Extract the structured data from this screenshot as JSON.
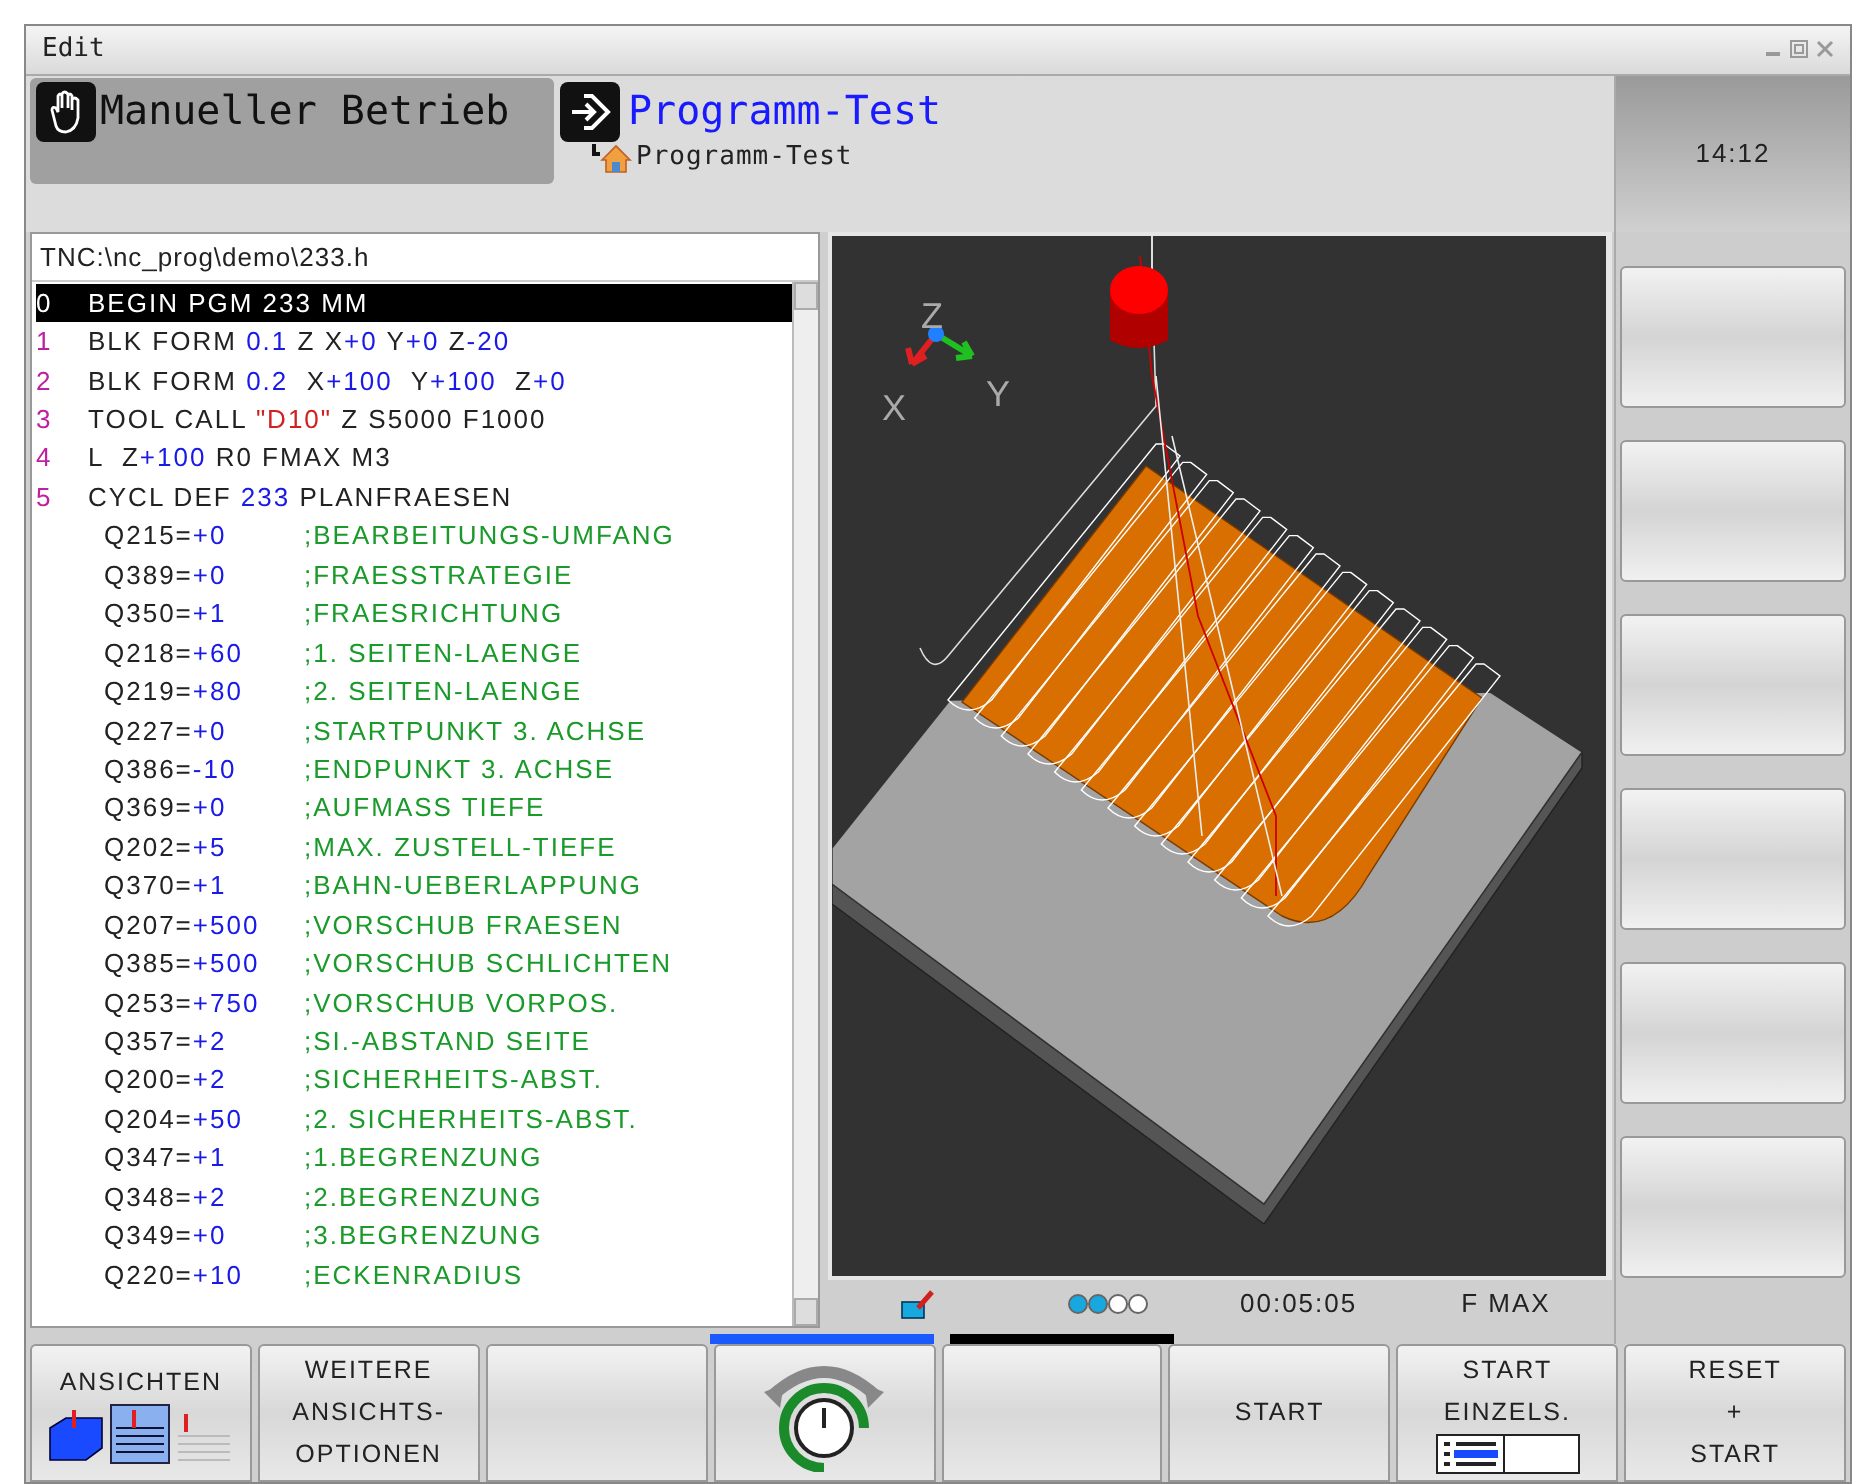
{
  "window": {
    "title": "Edit"
  },
  "modes": [
    {
      "kind": "manual",
      "label": "Manueller Betrieb",
      "selected": false
    },
    {
      "kind": "test",
      "label": "Programm-Test",
      "selected": true,
      "sublabel": "Programm-Test"
    }
  ],
  "clock": "14:12",
  "program": {
    "path": "TNC:\\nc_prog\\demo\\233.h",
    "lines": [
      {
        "kind": "block",
        "number": "0",
        "selected": true,
        "segments": [
          {
            "t": "BEGIN PGM 233 MM"
          }
        ]
      },
      {
        "kind": "block",
        "number": "1",
        "selected": false,
        "segments": [
          {
            "t": "BLK FORM ",
            "kind": "word"
          },
          {
            "t": "0.1",
            "kind": "num"
          },
          {
            "t": " Z X",
            "kind": "word"
          },
          {
            "t": "+0",
            "kind": "num"
          },
          {
            "t": " Y",
            "kind": "word"
          },
          {
            "t": "+0",
            "kind": "num"
          },
          {
            "t": " Z",
            "kind": "word"
          },
          {
            "t": "-20",
            "kind": "num"
          }
        ]
      },
      {
        "kind": "block",
        "number": "2",
        "selected": false,
        "segments": [
          {
            "t": "BLK FORM ",
            "kind": "word"
          },
          {
            "t": "0.2",
            "kind": "num"
          },
          {
            "t": "  X",
            "kind": "word"
          },
          {
            "t": "+100",
            "kind": "num"
          },
          {
            "t": "  Y",
            "kind": "word"
          },
          {
            "t": "+100",
            "kind": "num"
          },
          {
            "t": "  Z",
            "kind": "word"
          },
          {
            "t": "+0",
            "kind": "num"
          }
        ]
      },
      {
        "kind": "block",
        "number": "3",
        "selected": false,
        "segments": [
          {
            "t": "TOOL CALL ",
            "kind": "word"
          },
          {
            "t": "\"D10\"",
            "kind": "str"
          },
          {
            "t": " Z S5000 F1000",
            "kind": "word"
          }
        ]
      },
      {
        "kind": "block",
        "number": "4",
        "selected": false,
        "segments": [
          {
            "t": "L  Z",
            "kind": "word"
          },
          {
            "t": "+100",
            "kind": "num"
          },
          {
            "t": " R0 FMAX M3",
            "kind": "word"
          }
        ]
      },
      {
        "kind": "block",
        "number": "5",
        "selected": false,
        "segments": [
          {
            "t": "CYCL DEF ",
            "kind": "word"
          },
          {
            "t": "233",
            "kind": "num"
          },
          {
            "t": " PLANFRAESEN",
            "kind": "word"
          }
        ]
      },
      {
        "kind": "param",
        "name": "Q215=",
        "value": "+0",
        "comment": ";BEARBEITUNGS-UMFANG"
      },
      {
        "kind": "param",
        "name": "Q389=",
        "value": "+0",
        "comment": ";FRAESSTRATEGIE"
      },
      {
        "kind": "param",
        "name": "Q350=",
        "value": "+1",
        "comment": ";FRAESRICHTUNG"
      },
      {
        "kind": "param",
        "name": "Q218=",
        "value": "+60",
        "comment": ";1. SEITEN-LAENGE"
      },
      {
        "kind": "param",
        "name": "Q219=",
        "value": "+80",
        "comment": ";2. SEITEN-LAENGE"
      },
      {
        "kind": "param",
        "name": "Q227=",
        "value": "+0",
        "comment": ";STARTPUNKT 3. ACHSE"
      },
      {
        "kind": "param",
        "name": "Q386=",
        "value": "-10",
        "comment": ";ENDPUNKT 3. ACHSE"
      },
      {
        "kind": "param",
        "name": "Q369=",
        "value": "+0",
        "comment": ";AUFMASS TIEFE"
      },
      {
        "kind": "param",
        "name": "Q202=",
        "value": "+5",
        "comment": ";MAX. ZUSTELL-TIEFE"
      },
      {
        "kind": "param",
        "name": "Q370=",
        "value": "+1",
        "comment": ";BAHN-UEBERLAPPUNG"
      },
      {
        "kind": "param",
        "name": "Q207=",
        "value": "+500",
        "comment": ";VORSCHUB FRAESEN"
      },
      {
        "kind": "param",
        "name": "Q385=",
        "value": "+500",
        "comment": ";VORSCHUB SCHLICHTEN"
      },
      {
        "kind": "param",
        "name": "Q253=",
        "value": "+750",
        "comment": ";VORSCHUB VORPOS."
      },
      {
        "kind": "param",
        "name": "Q357=",
        "value": "+2",
        "comment": ";SI.-ABSTAND SEITE"
      },
      {
        "kind": "param",
        "name": "Q200=",
        "value": "+2",
        "comment": ";SICHERHEITS-ABST."
      },
      {
        "kind": "param",
        "name": "Q204=",
        "value": "+50",
        "comment": ";2. SICHERHEITS-ABST."
      },
      {
        "kind": "param",
        "name": "Q347=",
        "value": "+1",
        "comment": ";1.BEGRENZUNG"
      },
      {
        "kind": "param",
        "name": "Q348=",
        "value": "+2",
        "comment": ";2.BEGRENZUNG"
      },
      {
        "kind": "param",
        "name": "Q349=",
        "value": "+0",
        "comment": ";3.BEGRENZUNG"
      },
      {
        "kind": "param",
        "name": "Q220=",
        "value": "+10",
        "comment": ";ECKENRADIUS"
      }
    ]
  },
  "simulation": {
    "axes": [
      "X",
      "Y",
      "Z"
    ]
  },
  "status": {
    "speed_dots": [
      {
        "on": true
      },
      {
        "on": true
      },
      {
        "on": false
      },
      {
        "on": false
      }
    ],
    "time": "00:05:05",
    "feed": "F MAX"
  },
  "softkey_pages": [
    {
      "selected": true
    },
    {
      "selected": false
    }
  ],
  "vertical_softkeys": [
    {
      "kind": "empty"
    },
    {
      "kind": "empty"
    },
    {
      "kind": "empty"
    },
    {
      "kind": "empty"
    },
    {
      "kind": "empty"
    },
    {
      "kind": "empty"
    }
  ],
  "softkeys": [
    {
      "kind": "views",
      "lines": [
        "ANSICHTEN"
      ]
    },
    {
      "kind": "text",
      "lines": [
        "WEITERE",
        "ANSICHTS-",
        "OPTIONEN"
      ]
    },
    {
      "kind": "empty"
    },
    {
      "kind": "dial"
    },
    {
      "kind": "empty"
    },
    {
      "kind": "text",
      "lines": [
        "START"
      ]
    },
    {
      "kind": "single",
      "lines": [
        "START",
        "EINZELS."
      ]
    },
    {
      "kind": "text",
      "lines": [
        "RESET",
        "+",
        "START"
      ]
    }
  ]
}
